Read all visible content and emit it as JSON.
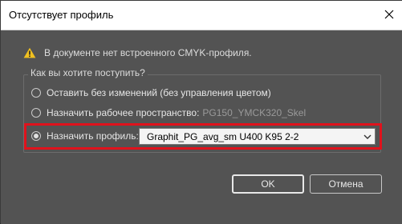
{
  "dialog": {
    "title": "Отсутствует профиль",
    "warning": "В документе нет встроенного CMYK-профиля.",
    "group_label": "Как вы хотите поступить?",
    "options": [
      {
        "label": "Оставить без изменений (без управления цветом)",
        "extra": "",
        "checked": false
      },
      {
        "label": "Назначить рабочее пространство:",
        "extra": "PG150_YMCK320_Skel",
        "checked": false
      },
      {
        "label": "Назначить профиль:",
        "extra": "",
        "checked": true
      }
    ],
    "profile_select": {
      "value": "Graphit_PG_avg_sm U400 K95 2-2"
    },
    "ok_label": "OK",
    "cancel_label": "Отмена"
  },
  "colors": {
    "highlight": "#e0121c",
    "warning": "#f0c020"
  },
  "icons": {
    "close": "close-icon",
    "warning": "warning-icon",
    "dropdown": "chevron-down-icon"
  }
}
